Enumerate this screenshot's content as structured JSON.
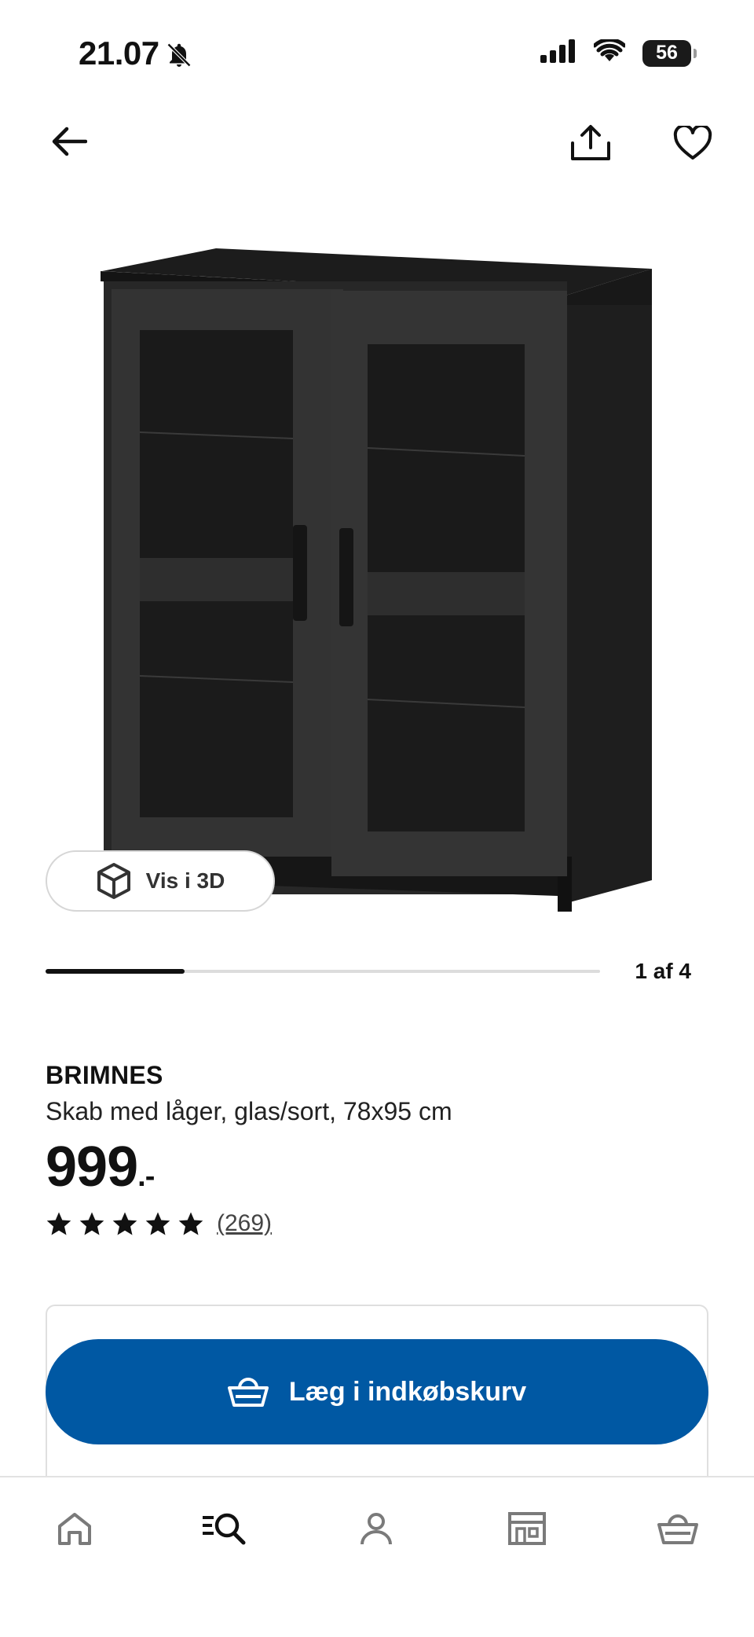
{
  "status_bar": {
    "time": "21.07",
    "battery": "56"
  },
  "top_nav": {
    "back_icon": "arrow-left-icon",
    "share_icon": "share-icon",
    "favorite_icon": "heart-icon"
  },
  "media": {
    "view_3d_label": "Vis i 3D",
    "page_counter": "1 af 4",
    "progress_fraction": 0.25
  },
  "product": {
    "brand": "BRIMNES",
    "description": "Skab med låger, glas/sort, 78x95 cm",
    "price_main": "999",
    "price_suffix": ".-",
    "rating_stars": 5,
    "review_count": "(269)"
  },
  "cart": {
    "add_to_cart_label": "Læg i indkøbskurv"
  },
  "bottom_nav": {
    "items": [
      "home-icon",
      "search-icon",
      "profile-icon",
      "store-icon",
      "cart-icon"
    ],
    "active": "search-icon"
  },
  "colors": {
    "primary_blue": "#0058a3",
    "text": "#111111"
  }
}
